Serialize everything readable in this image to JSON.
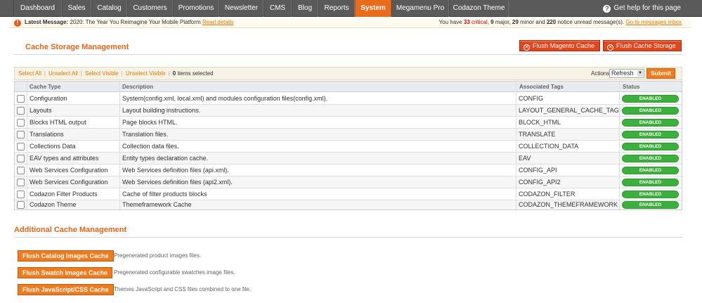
{
  "nav": {
    "items": [
      "Dashboard",
      "Sales",
      "Catalog",
      "Customers",
      "Promotions",
      "Newsletter",
      "CMS",
      "Blog",
      "Reports",
      "System",
      "Megamenu Pro",
      "Codazon Theme"
    ],
    "active": "System",
    "help": "Get help for this page"
  },
  "message": {
    "label": "Latest Message:",
    "text": "2020: The Year You Reimagine Your Mobile Platform",
    "read_details": "Read details",
    "pre": "You have",
    "critical_count": "33",
    "critical_label": "critical",
    "major_count": "9",
    "major_label": "major,",
    "minor_count": "29",
    "minor_label": "minor and",
    "notice_count": "220",
    "notice_label": "notice unread message(s).",
    "goto": "Go to messages inbox"
  },
  "cache_section": {
    "title": "Cache Storage Management",
    "flush_magento": "Flush Magento Cache",
    "flush_storage": "Flush Cache Storage"
  },
  "massaction": {
    "select_all": "Select All",
    "unselect_all": "Unselect All",
    "select_visible": "Select Visible",
    "unselect_visible": "Unselect Visible",
    "selected_count": "0",
    "selected_text": "items selected",
    "actions_label": "Actions",
    "actions_value": "Refresh",
    "submit": "Submit"
  },
  "table": {
    "columns": [
      "Cache Type",
      "Description",
      "Associated Tags",
      "Status"
    ],
    "rows": [
      {
        "type": "Configuration",
        "desc": "System(config.xml, local.xml) and modules configuration files(config.xml).",
        "tag": "CONFIG",
        "status": "ENABLED"
      },
      {
        "type": "Layouts",
        "desc": "Layout building instructions.",
        "tag": "LAYOUT_GENERAL_CACHE_TAG",
        "status": "ENABLED"
      },
      {
        "type": "Blocks HTML output",
        "desc": "Page blocks HTML.",
        "tag": "BLOCK_HTML",
        "status": "ENABLED"
      },
      {
        "type": "Translations",
        "desc": "Translation files.",
        "tag": "TRANSLATE",
        "status": "ENABLED"
      },
      {
        "type": "Collections Data",
        "desc": "Collection data files.",
        "tag": "COLLECTION_DATA",
        "status": "ENABLED"
      },
      {
        "type": "EAV types and attributes",
        "desc": "Entity types declaration cache.",
        "tag": "EAV",
        "status": "ENABLED"
      },
      {
        "type": "Web Services Configuration",
        "desc": "Web Services definition files (api.xml).",
        "tag": "CONFIG_API",
        "status": "ENABLED"
      },
      {
        "type": "Web Services Configuration",
        "desc": "Web Services definition files (api2.xml).",
        "tag": "CONFIG_API2",
        "status": "ENABLED"
      },
      {
        "type": "Codazon Filter Products",
        "desc": "Cache of filter products blocks",
        "tag": "CODAZON_FILTER",
        "status": "ENABLED"
      },
      {
        "type": "Codazon Theme",
        "desc": "Themeframework Cache",
        "tag": "CODAZON_THEMEFRAMEWORK",
        "status": "ENABLED"
      }
    ]
  },
  "additional": {
    "title": "Additional Cache Management",
    "buttons": [
      {
        "label": "Flush Catalog Images Cache",
        "desc": "Pregenerated product images files."
      },
      {
        "label": "Flush Swatch Images Cache",
        "desc": "Pregenerated configurable swatches image files."
      },
      {
        "label": "Flush JavaScript/CSS Cache",
        "desc": "Themes JavaScript and CSS files combined to one file."
      }
    ]
  }
}
